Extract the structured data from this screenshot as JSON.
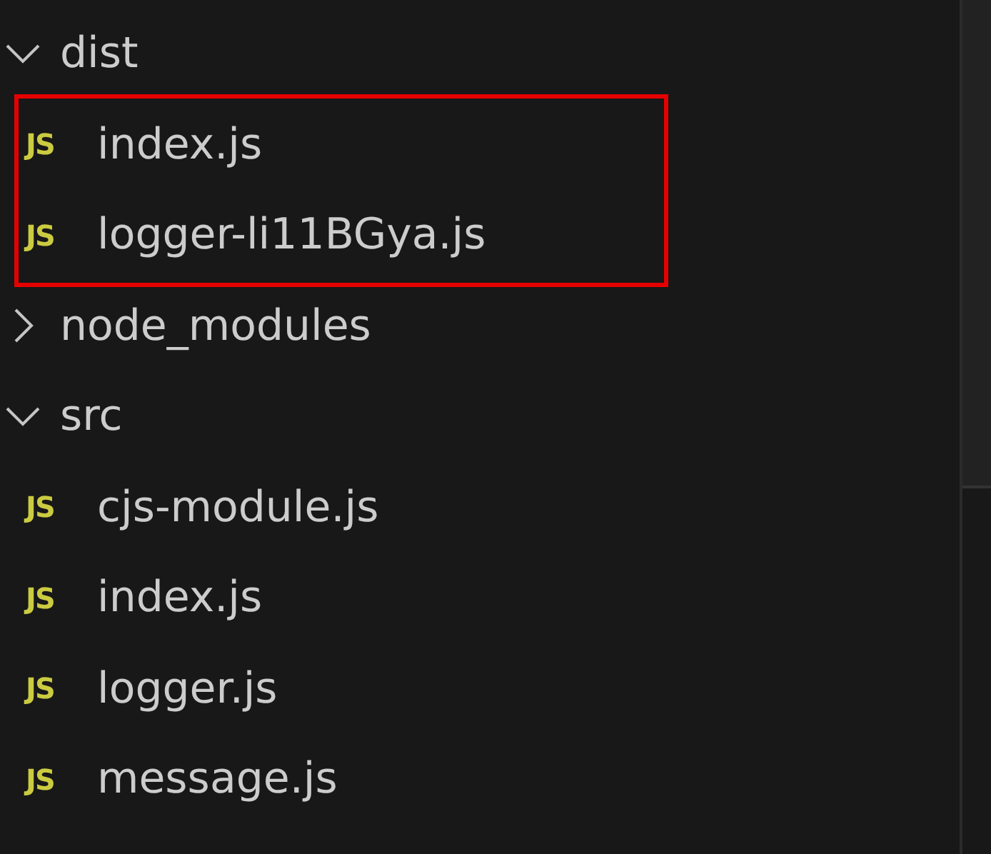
{
  "tree": [
    {
      "name": "dist",
      "kind": "folder",
      "expanded": true,
      "children": [
        {
          "name": "index.js",
          "kind": "js",
          "icon": "JS",
          "marked": true
        },
        {
          "name": "logger-li11BGya.js",
          "kind": "js",
          "icon": "JS",
          "marked": true
        }
      ]
    },
    {
      "name": "node_modules",
      "kind": "folder",
      "expanded": false
    },
    {
      "name": "src",
      "kind": "folder",
      "expanded": true,
      "children": [
        {
          "name": "cjs-module.js",
          "kind": "js",
          "icon": "JS",
          "marked": false
        },
        {
          "name": "index.js",
          "kind": "js",
          "icon": "JS",
          "marked": false
        },
        {
          "name": "logger.js",
          "kind": "js",
          "icon": "JS",
          "marked": false
        },
        {
          "name": "message.js",
          "kind": "js",
          "icon": "JS",
          "marked": false
        }
      ]
    }
  ]
}
